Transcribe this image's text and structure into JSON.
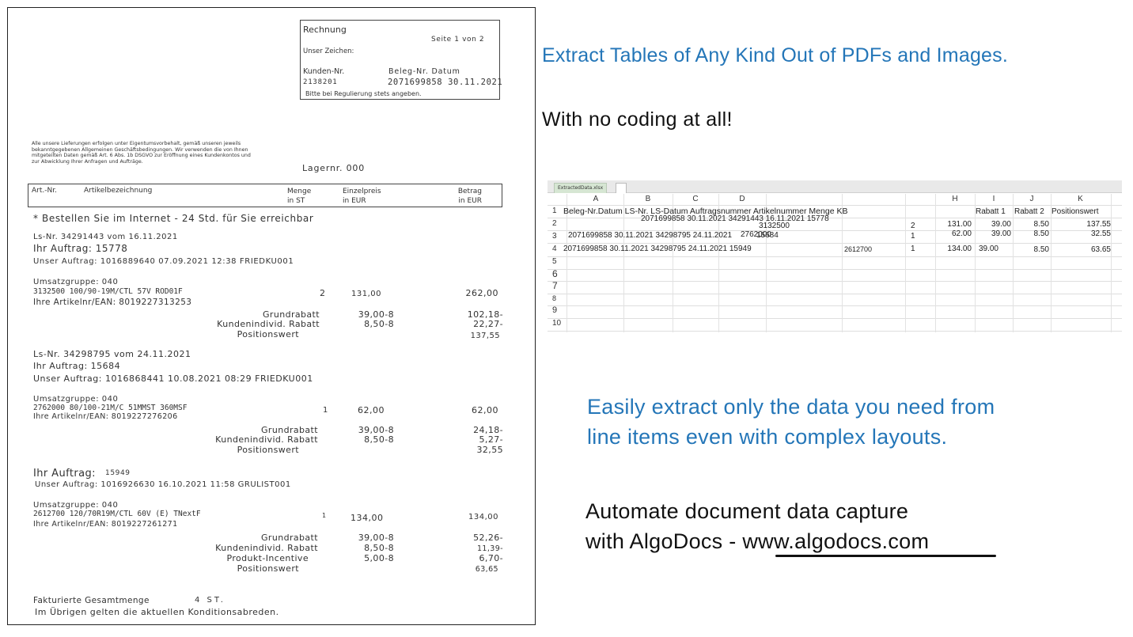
{
  "invoice": {
    "header_box": {
      "title": "Rechnung",
      "page": "Seite 1 von 2",
      "unser_zeichen": "Unser Zeichen:",
      "kunden_label": "Kunden-Nr.",
      "beleg_label": "Beleg-Nr. Datum",
      "kunden_nr": "2138201",
      "beleg_nr_datum": "2071699858 30.11.2021",
      "regulierung": "Bitte bei Regulierung stets angeben."
    },
    "legal_lines": [
      "Alle unsere Lieferungen erfolgen unter Eigentumsvorbehalt, gemäß unseren jeweils",
      "bekanntgegebenen Allgemeinen Geschäftsbedingungen. Wir verwenden die von Ihnen",
      "mitgeteilten Daten gemäß Art. 6 Abs. 1b DSGVO zur Eröffnung eines Kundenkontos und",
      "zur Abwicklung Ihrer Anfragen und Aufträge."
    ],
    "lagernr": "Lagernr. 000",
    "columns": {
      "art_nr": "Art.-Nr.",
      "bezeichnung": "Artikelbezeichnung",
      "menge": "Menge",
      "menge_unit": "in ST",
      "einzelpreis": "Einzelpreis",
      "einzelpreis_unit": "in EUR",
      "betrag": "Betrag",
      "betrag_unit": "in EUR"
    },
    "internet_note": "* Bestellen Sie im Internet - 24 Std. für Sie erreichbar",
    "block1": {
      "ls": "Ls-Nr. 34291443 vom 16.11.2021",
      "auftrag": "Ihr Auftrag: 15778",
      "unser_auftrag": "Unser Auftrag: 1016889640 07.09.2021 12:38 FRIEDKU001",
      "umsatzgruppe": "Umsatzgruppe: 040",
      "article": "3132500 100/90-19M/CTL 57V ROD01F",
      "qty": "2",
      "price": "131,00",
      "amount": "262,00",
      "ean": "Ihre Artikelnr/EAN: 8019227313253",
      "lines": [
        {
          "label": "Grundrabatt",
          "pct": "39,00-8",
          "val": "102,18-"
        },
        {
          "label": "Kundenindivid. Rabatt",
          "pct": "8,50-8",
          "val": "22,27-"
        },
        {
          "label": "Positionswert",
          "pct": "",
          "val": "137,55"
        }
      ]
    },
    "block2": {
      "ls": "Ls-Nr. 34298795 vom 24.11.2021",
      "auftrag": "Ihr Auftrag: 15684",
      "unser_auftrag": "Unser Auftrag: 1016868441 10.08.2021 08:29 FRIEDKU001",
      "umsatzgruppe": "Umsatzgruppe: 040",
      "article": "2762000 80/100-21M/C 51MMST 360MSF",
      "qty": "1",
      "price": "62,00",
      "amount": "62,00",
      "ean": "Ihre Artikelnr/EAN: 8019227276206",
      "lines": [
        {
          "label": "Grundrabatt",
          "pct": "39,00-8",
          "val": "24,18-"
        },
        {
          "label": "Kundenindivid. Rabatt",
          "pct": "8,50-8",
          "val": "5,27-"
        },
        {
          "label": "Positionswert",
          "pct": "",
          "val": "32,55"
        }
      ]
    },
    "block3": {
      "auftrag_label": "Ihr Auftrag:",
      "auftrag_nr": "15949",
      "unser_auftrag": "Unser Auftrag: 1016926630 16.10.2021 11:58 GRULIST001",
      "umsatzgruppe": "Umsatzgruppe: 040",
      "article": "2612700 120/70R19M/CTL 60V (E) TNextF",
      "qty": "1",
      "price": "134,00",
      "amount": "134,00",
      "ean": "Ihre Artikelnr/EAN: 8019227261271",
      "lines": [
        {
          "label": "Grundrabatt",
          "pct": "39,00-8",
          "val": "52,26-"
        },
        {
          "label": "Kundenindivid. Rabatt",
          "pct": "8,50-8",
          "val": "11,39-"
        },
        {
          "label": "Produkt-Incentive",
          "pct": "5,00-8",
          "val": "6,70-"
        },
        {
          "label": "Positionswert",
          "pct": "",
          "val": "63,65"
        }
      ]
    },
    "footer": {
      "gesamtmenge_label": "Fakturierte Gesamtmenge",
      "gesamtmenge_val": "4 ST.",
      "konditionen": "Im Übrigen gelten die aktuellen Konditionsabreden."
    }
  },
  "promo": {
    "headline": "Extract Tables of Any Kind Out of PDFs and Images.",
    "subheadline": "With no coding at all!",
    "blue_line1": "Easily extract only the data you need from",
    "blue_line2": "line items even with complex layouts.",
    "black_line1": "Automate document data capture",
    "black_line2_prefix": "with AlgoDocs - ",
    "black_line2_link": "www.algodocs.com",
    "accent_color": "#2476b8"
  },
  "spreadsheet": {
    "tab_name": "ExtractedData.xlsx",
    "col_letters": [
      "A",
      "B",
      "C",
      "D",
      "",
      "",
      "",
      "H",
      "I",
      "J",
      "K"
    ],
    "header_row": "Beleg-Nr.Datum LS-Nr. LS-Datum Auftragsnummer Artikelnummer Menge KB",
    "header_rabatt1": "Rabatt 1",
    "header_rabatt2": "Rabatt 2",
    "header_positionswert": "Positionswert",
    "row2_overflow": "2071699858 30.11.2021 34291443 16.11.2021 15778",
    "row2_article": "3132500",
    "row2_qty": "2",
    "row2_price": "131.00",
    "row2_r1": "39.00",
    "row2_r2": "8.50",
    "row2_pos": "137.55",
    "row3_text": "2071699858 30.11.2021 34298795 24.11.2021",
    "row3_article": "2762000",
    "row3_order": "15684",
    "row3_qty": "1",
    "row3_price": "62.00",
    "row3_r1": "39.00",
    "row3_r2": "8.50",
    "row3_pos": "32.55",
    "row4_text": "2071699858 30.11.2021 34298795 24.11.2021 15949",
    "row4_article": "2612700",
    "row4_qty": "1",
    "row4_price": "134.00",
    "row4_r1": "39.00",
    "row4_r2": "8.50",
    "row4_pos": "63.65",
    "row_numbers": [
      "1",
      "2",
      "3",
      "4",
      "5",
      "6",
      "7",
      "8",
      "9",
      "10"
    ]
  }
}
